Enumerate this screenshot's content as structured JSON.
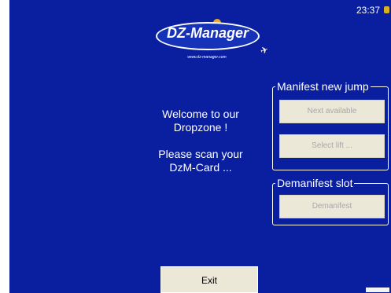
{
  "status_bar": {
    "time": "23:37"
  },
  "logo": {
    "title": "DZ-Manager",
    "url": "www.dz-manager.com"
  },
  "welcome": {
    "line1": "Welcome to our",
    "line2": "Dropzone !",
    "line3": "Please scan your",
    "line4": "DzM-Card ..."
  },
  "manifest_group": {
    "title": "Manifest new jump",
    "next_available_label": "Next available",
    "select_lift_label": "Select lift ..."
  },
  "demanifest_group": {
    "title": "Demanifest slot",
    "demanifest_label": "Demanifest"
  },
  "exit_label": "Exit",
  "colors": {
    "background": "#0a1fa0",
    "button_face": "#ece8d8",
    "disabled_text": "#a8a8a8"
  }
}
